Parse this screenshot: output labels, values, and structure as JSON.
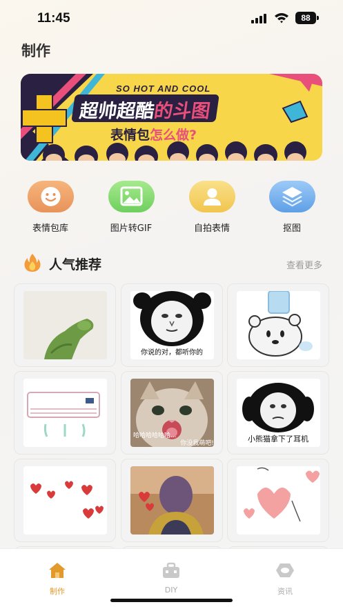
{
  "status_bar": {
    "time": "11:45",
    "battery": "88"
  },
  "page": {
    "title": "制作"
  },
  "banner": {
    "tagline": "SO HOT AND COOL",
    "headline_part1": "超帅超酷",
    "headline_part2": "的斗图",
    "subheadline_part1": "表情包",
    "subheadline_part2": "怎么做?"
  },
  "categories": [
    {
      "label": "表情包库",
      "icon": "smiley-icon",
      "color": "#f0a86a"
    },
    {
      "label": "图片转GIF",
      "icon": "image-icon",
      "color": "#8fdc7a"
    },
    {
      "label": "自拍表情",
      "icon": "person-icon",
      "color": "#f5d36b"
    },
    {
      "label": "抠图",
      "icon": "layers-icon",
      "color": "#7fb5ee"
    }
  ],
  "section": {
    "title": "人气推荐",
    "more": "查看更多"
  },
  "memes": [
    {
      "caption": ""
    },
    {
      "caption": "你说的对，都听你的"
    },
    {
      "caption": ""
    },
    {
      "caption": ""
    },
    {
      "caption": "哈哈哈哈哈哈...",
      "caption2": "你没我萌吧!"
    },
    {
      "caption": "小熊猫拿下了耳机"
    },
    {
      "caption": ""
    },
    {
      "caption": ""
    },
    {
      "caption": ""
    }
  ],
  "tabs": [
    {
      "label": "制作",
      "active": true
    },
    {
      "label": "DIY",
      "active": false
    },
    {
      "label": "资讯",
      "active": false
    }
  ],
  "colors": {
    "accent": "#e29a2d",
    "inactive": "#aaaaaa"
  }
}
